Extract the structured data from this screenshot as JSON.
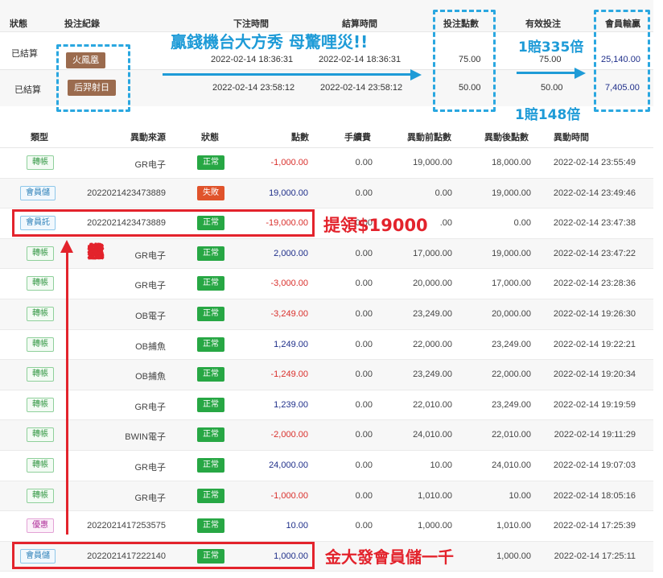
{
  "bets": {
    "headers": {
      "status": "狀態",
      "record": "投注紀錄",
      "bet_time": "下注時間",
      "settle_time": "結算時間",
      "bet_amount": "投注點數",
      "valid_bet": "有效投注",
      "payout": "會員輸贏"
    },
    "rows": [
      {
        "status": "已結算",
        "game": "火鳳凰",
        "bet_time": "2022-02-14 18:36:31",
        "settle_time": "2022-02-14 18:36:31",
        "bet_amount": "75.00",
        "valid_bet": "75.00",
        "payout": "25,140.00"
      },
      {
        "status": "已結算",
        "game": "后羿射日",
        "bet_time": "2022-02-14 23:58:12",
        "settle_time": "2022-02-14 23:58:12",
        "bet_amount": "50.00",
        "valid_bet": "50.00",
        "payout": "7,405.00"
      }
    ],
    "annotations": {
      "headline": "贏錢機台大方秀 母驚哩災!!",
      "ratio_1": "1賠335倍",
      "ratio_2": "1賠148倍"
    },
    "colors": {
      "annotation_blue": "#1e9bd7",
      "game_tag_bg": "#9b6b4e"
    }
  },
  "transactions": {
    "headers": {
      "type": "類型",
      "source": "異動來源",
      "status": "狀態",
      "points": "點數",
      "fee": "手續費",
      "before": "異動前點數",
      "after": "異動後點數",
      "time": "異動時間"
    },
    "rows": [
      {
        "type": "轉帳",
        "type_kind": "transfer",
        "source": "GR电子",
        "status": "正常",
        "status_kind": "ok",
        "points": "-1,000.00",
        "sign": "neg",
        "fee": "0.00",
        "before": "19,000.00",
        "after": "18,000.00",
        "time": "2022-02-14 23:55:49"
      },
      {
        "type": "會員儲",
        "type_kind": "deposit",
        "source": "2022021423473889",
        "status": "失敗",
        "status_kind": "fail",
        "points": "19,000.00",
        "sign": "pos",
        "fee": "0.00",
        "before": "0.00",
        "after": "19,000.00",
        "time": "2022-02-14 23:49:46"
      },
      {
        "type": "會員託",
        "type_kind": "deposit",
        "source": "2022021423473889",
        "status": "正常",
        "status_kind": "ok",
        "points": "-19,000.00",
        "sign": "neg",
        "fee": "0.00",
        "before": ".00",
        "after": "0.00",
        "time": "2022-02-14 23:47:38"
      },
      {
        "type": "轉帳",
        "type_kind": "transfer",
        "source": "GR电子",
        "status": "正常",
        "status_kind": "ok",
        "points": "2,000.00",
        "sign": "pos",
        "fee": "0.00",
        "before": "17,000.00",
        "after": "19,000.00",
        "time": "2022-02-14 23:47:22"
      },
      {
        "type": "轉帳",
        "type_kind": "transfer",
        "source": "GR电子",
        "status": "正常",
        "status_kind": "ok",
        "points": "-3,000.00",
        "sign": "neg",
        "fee": "0.00",
        "before": "20,000.00",
        "after": "17,000.00",
        "time": "2022-02-14 23:28:36"
      },
      {
        "type": "轉帳",
        "type_kind": "transfer",
        "source": "OB電子",
        "status": "正常",
        "status_kind": "ok",
        "points": "-3,249.00",
        "sign": "neg",
        "fee": "0.00",
        "before": "23,249.00",
        "after": "20,000.00",
        "time": "2022-02-14 19:26:30"
      },
      {
        "type": "轉帳",
        "type_kind": "transfer",
        "source": "OB捕魚",
        "status": "正常",
        "status_kind": "ok",
        "points": "1,249.00",
        "sign": "pos",
        "fee": "0.00",
        "before": "22,000.00",
        "after": "23,249.00",
        "time": "2022-02-14 19:22:21"
      },
      {
        "type": "轉帳",
        "type_kind": "transfer",
        "source": "OB捕魚",
        "status": "正常",
        "status_kind": "ok",
        "points": "-1,249.00",
        "sign": "neg",
        "fee": "0.00",
        "before": "23,249.00",
        "after": "22,000.00",
        "time": "2022-02-14 19:20:34"
      },
      {
        "type": "轉帳",
        "type_kind": "transfer",
        "source": "GR电子",
        "status": "正常",
        "status_kind": "ok",
        "points": "1,239.00",
        "sign": "pos",
        "fee": "0.00",
        "before": "22,010.00",
        "after": "23,249.00",
        "time": "2022-02-14 19:19:59"
      },
      {
        "type": "轉帳",
        "type_kind": "transfer",
        "source": "BWIN電子",
        "status": "正常",
        "status_kind": "ok",
        "points": "-2,000.00",
        "sign": "neg",
        "fee": "0.00",
        "before": "24,010.00",
        "after": "22,010.00",
        "time": "2022-02-14 19:11:29"
      },
      {
        "type": "轉帳",
        "type_kind": "transfer",
        "source": "GR电子",
        "status": "正常",
        "status_kind": "ok",
        "points": "24,000.00",
        "sign": "pos",
        "fee": "0.00",
        "before": "10.00",
        "after": "24,010.00",
        "time": "2022-02-14 19:07:03"
      },
      {
        "type": "轉帳",
        "type_kind": "transfer",
        "source": "GR电子",
        "status": "正常",
        "status_kind": "ok",
        "points": "-1,000.00",
        "sign": "neg",
        "fee": "0.00",
        "before": "1,010.00",
        "after": "10.00",
        "time": "2022-02-14 18:05:16"
      },
      {
        "type": "優惠",
        "type_kind": "promo",
        "source": "2022021417253575",
        "status": "正常",
        "status_kind": "ok",
        "points": "10.00",
        "sign": "pos",
        "fee": "0.00",
        "before": "1,000.00",
        "after": "1,010.00",
        "time": "2022-02-14 17:25:39"
      },
      {
        "type": "會員儲",
        "type_kind": "deposit",
        "source": "2022021417222140",
        "status": "正常",
        "status_kind": "ok",
        "points": "1,000.00",
        "sign": "pos",
        "fee": "",
        "before": "",
        "after": "1,000.00",
        "time": "2022-02-14 17:25:11"
      }
    ],
    "annotations": {
      "withdraw": "提領$19000",
      "vertical": [
        "想",
        "以",
        "小",
        "搏",
        "大",
        "就",
        "來",
        "金",
        "大",
        "發"
      ],
      "deposit_note": "金大發會員儲一千"
    },
    "colors": {
      "negative": "#d9302c",
      "positive": "#1f2f8a",
      "status_ok": "#27a744",
      "status_fail": "#e0532b",
      "annotation_red": "#e3232c"
    }
  }
}
